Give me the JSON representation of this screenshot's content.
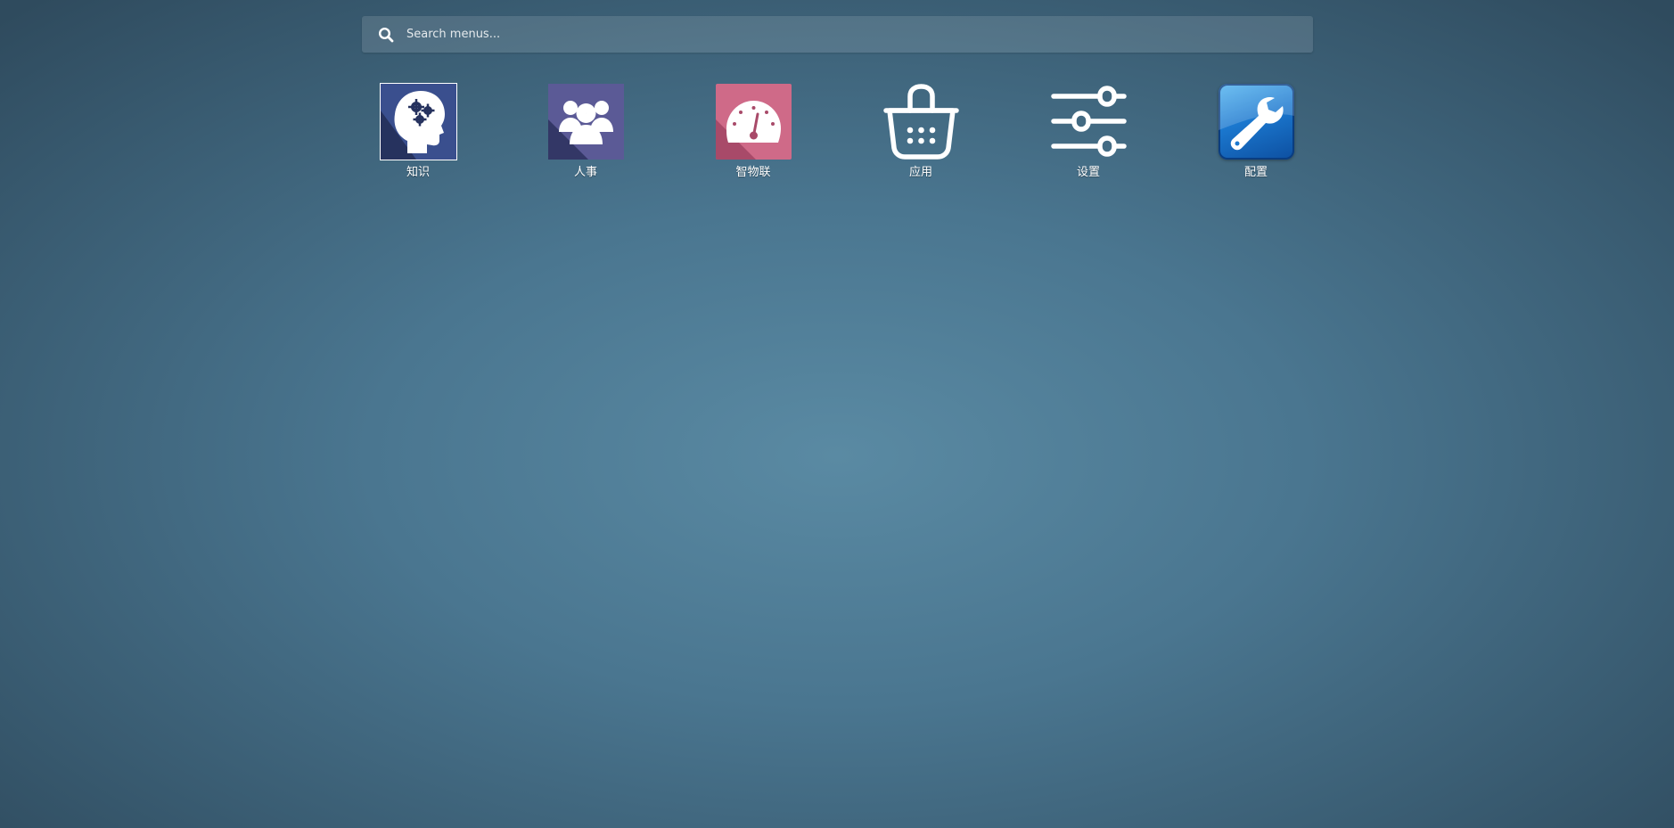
{
  "search": {
    "placeholder": "Search menus..."
  },
  "apps": [
    {
      "label": "知识",
      "icon": "knowledge-head-gears-icon",
      "color": "#3a4f8e"
    },
    {
      "label": "人事",
      "icon": "users-group-icon",
      "color": "#5b5a96"
    },
    {
      "label": "智物联",
      "icon": "speedometer-icon",
      "color": "#cf6a88"
    },
    {
      "label": "应用",
      "icon": "shopping-basket-icon",
      "color": "transparent"
    },
    {
      "label": "设置",
      "icon": "sliders-icon",
      "color": "transparent"
    },
    {
      "label": "配置",
      "icon": "wrench-icon",
      "color": "#1b78cf"
    }
  ]
}
